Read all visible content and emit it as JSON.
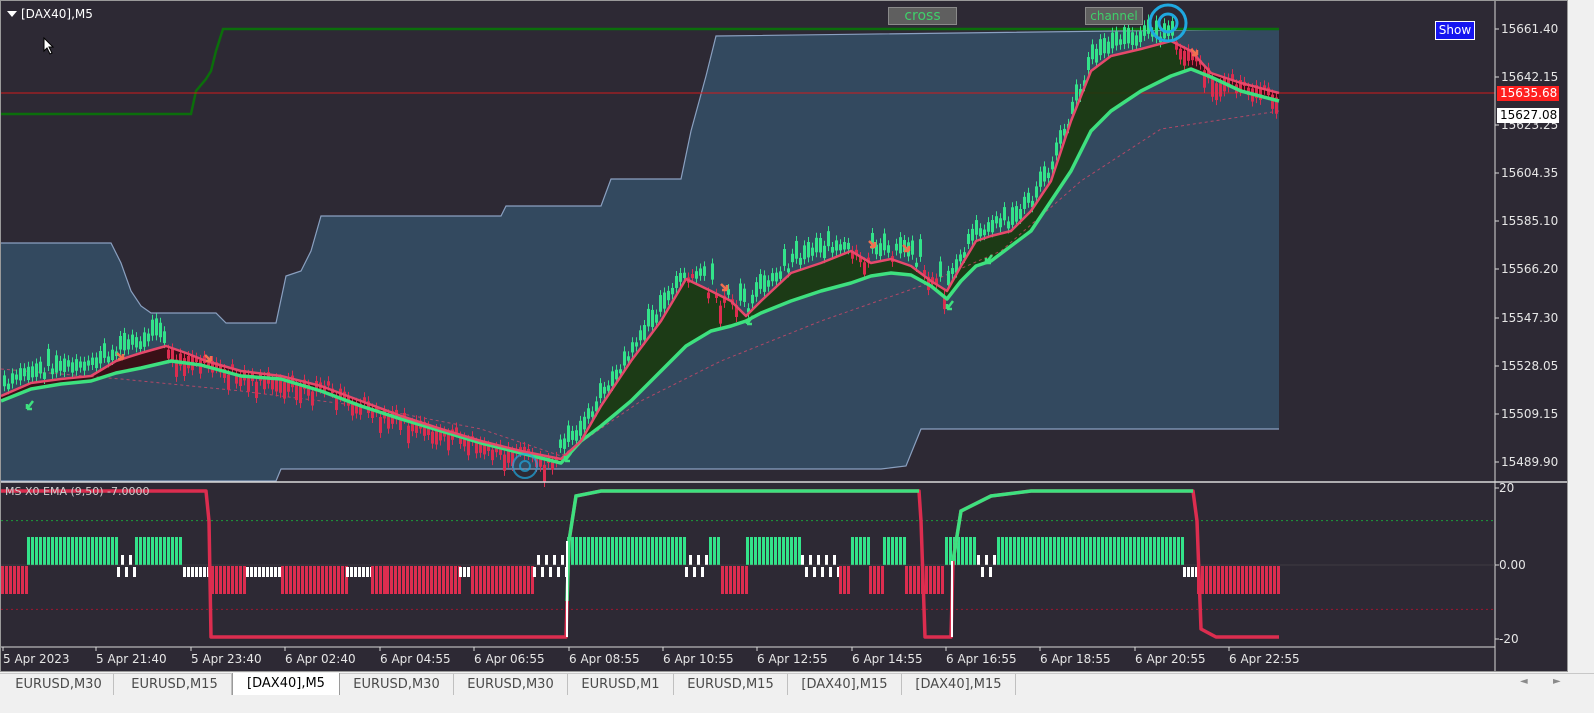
{
  "chart": {
    "symbol": "[DAX40],M5",
    "buttons": {
      "cross": "cross",
      "channel": "channel",
      "show": "Show"
    },
    "indicator_label": "MS X0 EMA (9,50) -7.0000",
    "current_price_label": "15635.68",
    "second_price_label": "15627.08",
    "price_axis": [
      "15661.40",
      "15642.15",
      "15623.25",
      "15604.35",
      "15585.10",
      "15566.20",
      "15547.30",
      "15528.05",
      "15509.15",
      "15489.90"
    ],
    "indicator_axis": [
      "20",
      "0.00",
      "-20"
    ],
    "time_axis": [
      "5 Apr 2023",
      "5 Apr 21:40",
      "5 Apr 23:40",
      "6 Apr 02:40",
      "6 Apr 04:55",
      "6 Apr 06:55",
      "6 Apr 08:55",
      "6 Apr 10:55",
      "6 Apr 12:55",
      "6 Apr 14:55",
      "6 Apr 16:55",
      "6 Apr 18:55",
      "6 Apr 20:55",
      "6 Apr 22:55"
    ],
    "colors": {
      "background": "#2d2934",
      "channel_fill": "#33495f",
      "channel_line": "#8aa0c0",
      "upper_band": "#0b6e0b",
      "bull": "#33e38a",
      "bear": "#dc2d4f",
      "fast_ema": "#e6496b",
      "slow_ema": "#3ee07f",
      "ribbon_up": "#1a3a0e",
      "ribbon_down": "#3a0a10",
      "price_line": "#d01b1b",
      "accent": "#1fa8e0"
    },
    "icons": [
      "cursor-arrow-icon",
      "dropdown-triangle-icon",
      "target-circle-icon",
      "buy-arrow-icon",
      "sell-arrow-icon"
    ]
  },
  "chart_data": {
    "type": "line",
    "title": "[DAX40],M5",
    "x": [
      "5 Apr 2023",
      "5 Apr 21:40",
      "5 Apr 23:40",
      "6 Apr 02:40",
      "6 Apr 04:55",
      "6 Apr 06:55",
      "6 Apr 08:55",
      "6 Apr 10:55",
      "6 Apr 12:55",
      "6 Apr 14:55",
      "6 Apr 16:55",
      "6 Apr 18:55",
      "6 Apr 20:55",
      "6 Apr 22:55"
    ],
    "series": [
      {
        "values": [
          15522,
          15535,
          15530,
          15522,
          15512,
          15500,
          15535,
          15556,
          15564,
          15568,
          15572,
          15620,
          15654,
          15632
        ]
      },
      {
        "values": [
          15518,
          15530,
          15532,
          15524,
          15514,
          15503,
          15520,
          15548,
          15558,
          15565,
          15568,
          15598,
          15640,
          15630
        ]
      }
    ],
    "ylim": [
      15485,
      15668
    ],
    "indicator": {
      "ylim": [
        -22,
        22
      ],
      "levels": [
        20,
        0,
        -20
      ],
      "dotted_levels": [
        12,
        -12
      ]
    },
    "current_price": 15635.68
  },
  "tabs": [
    {
      "label": "EURUSD,M30",
      "active": false
    },
    {
      "label": "EURUSD,M15",
      "active": false
    },
    {
      "label": "[DAX40],M5",
      "active": true
    },
    {
      "label": "EURUSD,M30",
      "active": false
    },
    {
      "label": "EURUSD,M30",
      "active": false
    },
    {
      "label": "EURUSD,M1",
      "active": false
    },
    {
      "label": "EURUSD,M15",
      "active": false
    },
    {
      "label": "[DAX40],M15",
      "active": false
    },
    {
      "label": "[DAX40],M15",
      "active": false
    }
  ],
  "tab_scroll": {
    "prev": "◄",
    "next": "►"
  }
}
